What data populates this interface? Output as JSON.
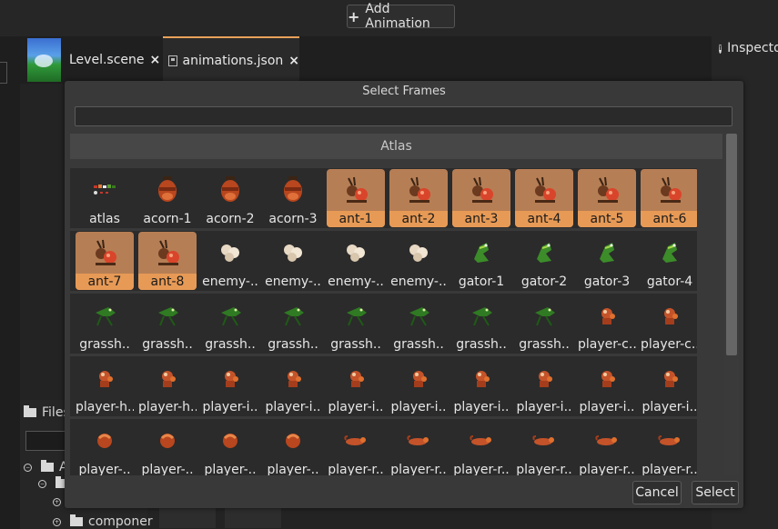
{
  "toolbar": {
    "add_animation_label": "Add Animation"
  },
  "tabs": [
    {
      "label": "Level.scene",
      "close": "×"
    },
    {
      "label": "animations.json",
      "close": "×"
    }
  ],
  "inspector": {
    "title": "Inspecto"
  },
  "files_panel": {
    "title": "Files",
    "tree": [
      {
        "label": "An",
        "toggle": "−"
      },
      {
        "label": "",
        "toggle": "−"
      },
      {
        "label": "",
        "toggle": "+"
      },
      {
        "label": "componer",
        "toggle": "+"
      }
    ]
  },
  "dialog": {
    "title": "Select Frames",
    "filter_value": "",
    "section_title": "Atlas",
    "cancel_label": "Cancel",
    "select_label": "Select",
    "rows": [
      [
        {
          "label": "atlas",
          "icon": "atlas-sprite-icon",
          "selected": false
        },
        {
          "label": "acorn-1",
          "icon": "acorn-sprite-icon",
          "selected": false
        },
        {
          "label": "acorn-2",
          "icon": "acorn-sprite-icon",
          "selected": false
        },
        {
          "label": "acorn-3",
          "icon": "acorn-sprite-icon",
          "selected": false
        },
        {
          "label": "ant-1",
          "icon": "ant-sprite-icon",
          "selected": true
        },
        {
          "label": "ant-2",
          "icon": "ant-sprite-icon",
          "selected": true
        },
        {
          "label": "ant-3",
          "icon": "ant-sprite-icon",
          "selected": true
        },
        {
          "label": "ant-4",
          "icon": "ant-sprite-icon",
          "selected": true
        },
        {
          "label": "ant-5",
          "icon": "ant-sprite-icon",
          "selected": true
        },
        {
          "label": "ant-6",
          "icon": "ant-sprite-icon",
          "selected": true
        }
      ],
      [
        {
          "label": "ant-7",
          "icon": "ant-sprite-icon",
          "selected": true
        },
        {
          "label": "ant-8",
          "icon": "ant-sprite-icon",
          "selected": true
        },
        {
          "label": "enemy-..",
          "icon": "smoke-sprite-icon",
          "selected": false
        },
        {
          "label": "enemy-..",
          "icon": "smoke-sprite-icon",
          "selected": false
        },
        {
          "label": "enemy-..",
          "icon": "smoke-sprite-icon",
          "selected": false
        },
        {
          "label": "enemy-..",
          "icon": "smoke-sprite-icon",
          "selected": false
        },
        {
          "label": "gator-1",
          "icon": "gator-sprite-icon",
          "selected": false
        },
        {
          "label": "gator-2",
          "icon": "gator-sprite-icon",
          "selected": false
        },
        {
          "label": "gator-3",
          "icon": "gator-sprite-icon",
          "selected": false
        },
        {
          "label": "gator-4",
          "icon": "gator-sprite-icon",
          "selected": false
        }
      ],
      [
        {
          "label": "grassh..",
          "icon": "grasshopper-sprite-icon",
          "selected": false
        },
        {
          "label": "grassh..",
          "icon": "grasshopper-sprite-icon",
          "selected": false
        },
        {
          "label": "grassh..",
          "icon": "grasshopper-sprite-icon",
          "selected": false
        },
        {
          "label": "grassh..",
          "icon": "grasshopper-sprite-icon",
          "selected": false
        },
        {
          "label": "grassh..",
          "icon": "grasshopper-sprite-icon",
          "selected": false
        },
        {
          "label": "grassh..",
          "icon": "grasshopper-sprite-icon",
          "selected": false
        },
        {
          "label": "grassh..",
          "icon": "grasshopper-sprite-icon",
          "selected": false
        },
        {
          "label": "grassh..",
          "icon": "grasshopper-sprite-icon",
          "selected": false
        },
        {
          "label": "player-c..",
          "icon": "player-sprite-icon",
          "selected": false
        },
        {
          "label": "player-c..",
          "icon": "player-sprite-icon",
          "selected": false
        }
      ],
      [
        {
          "label": "player-h..",
          "icon": "player-sprite-icon",
          "selected": false
        },
        {
          "label": "player-h..",
          "icon": "player-sprite-icon",
          "selected": false
        },
        {
          "label": "player-i..",
          "icon": "player-sprite-icon",
          "selected": false
        },
        {
          "label": "player-i..",
          "icon": "player-sprite-icon",
          "selected": false
        },
        {
          "label": "player-i..",
          "icon": "player-sprite-icon",
          "selected": false
        },
        {
          "label": "player-i..",
          "icon": "player-sprite-icon",
          "selected": false
        },
        {
          "label": "player-i..",
          "icon": "player-sprite-icon",
          "selected": false
        },
        {
          "label": "player-i..",
          "icon": "player-sprite-icon",
          "selected": false
        },
        {
          "label": "player-i..",
          "icon": "player-sprite-icon",
          "selected": false
        },
        {
          "label": "player-i..",
          "icon": "player-sprite-icon",
          "selected": false
        }
      ],
      [
        {
          "label": "player-..",
          "icon": "player-roll-sprite-icon",
          "selected": false
        },
        {
          "label": "player-..",
          "icon": "player-roll-sprite-icon",
          "selected": false
        },
        {
          "label": "player-..",
          "icon": "player-roll-sprite-icon",
          "selected": false
        },
        {
          "label": "player-..",
          "icon": "player-roll-sprite-icon",
          "selected": false
        },
        {
          "label": "player-r..",
          "icon": "player-run-sprite-icon",
          "selected": false
        },
        {
          "label": "player-r..",
          "icon": "player-run-sprite-icon",
          "selected": false
        },
        {
          "label": "player-r..",
          "icon": "player-run-sprite-icon",
          "selected": false
        },
        {
          "label": "player-r..",
          "icon": "player-run-sprite-icon",
          "selected": false
        },
        {
          "label": "player-r..",
          "icon": "player-run-sprite-icon",
          "selected": false
        },
        {
          "label": "player-r..",
          "icon": "player-run-sprite-icon",
          "selected": false
        }
      ]
    ]
  },
  "colors": {
    "accent": "#e79a56",
    "selected_cell": "#b67e55",
    "dialog_bg": "#393939",
    "app_bg": "#232323"
  }
}
